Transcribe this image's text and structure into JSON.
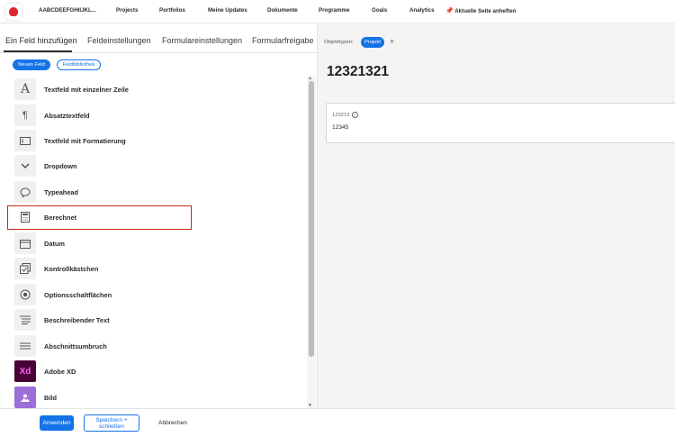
{
  "nav": {
    "app_name": "AABCDEEFGHIIJKL...",
    "items": [
      "Projects",
      "Portfolios",
      "Meine Updates",
      "Dokumente",
      "Programme",
      "Goals",
      "Analytics"
    ],
    "pin_label": "Aktuelle Seite anheften"
  },
  "left": {
    "tabs": [
      "Ein Feld hinzufügen",
      "Feldeinstellungen",
      "Formulareinstellungen",
      "Formularfreigabe"
    ],
    "pills": {
      "new_field": "Neues Feld",
      "library": "Feldbibliothek"
    },
    "fields": [
      {
        "label": "Textfeld mit einzelner Zeile",
        "icon": "text-a-icon"
      },
      {
        "label": "Absatztextfeld",
        "icon": "paragraph-icon"
      },
      {
        "label": "Textfeld mit Formatierung",
        "icon": "rich-text-icon"
      },
      {
        "label": "Dropdown",
        "icon": "chevron-down-icon"
      },
      {
        "label": "Typeahead",
        "icon": "chat-bubble-icon"
      },
      {
        "label": "Berechnet",
        "icon": "calculator-icon"
      },
      {
        "label": "Datum",
        "icon": "calendar-icon"
      },
      {
        "label": "Kontrollkästchen",
        "icon": "checkbox-icon"
      },
      {
        "label": "Optionsschaltflächen",
        "icon": "radio-icon"
      },
      {
        "label": "Beschreibender Text",
        "icon": "text-lines-icon"
      },
      {
        "label": "Abschnittsumbruch",
        "icon": "section-break-icon"
      },
      {
        "label": "Adobe XD",
        "icon": "adobe-xd-icon"
      },
      {
        "label": "Bild",
        "icon": "image-icon"
      }
    ],
    "highlighted_field": "Berechnet"
  },
  "footer": {
    "apply": "Anwenden",
    "save_line1": "Speichern +",
    "save_line2": "schließen",
    "cancel": "Abbrechen"
  },
  "right": {
    "object_types_label": "Objekttypen:",
    "object_pill": "Projekt",
    "add_symbol": "+",
    "form_title": "12321321",
    "card_label": "123213",
    "card_value": "12345"
  },
  "colors": {
    "accent": "#1473e6",
    "highlight_border": "#c0281c",
    "xd_bg": "#470137",
    "xd_text": "#ff61f6",
    "image_bg": "#9a6fd8"
  }
}
